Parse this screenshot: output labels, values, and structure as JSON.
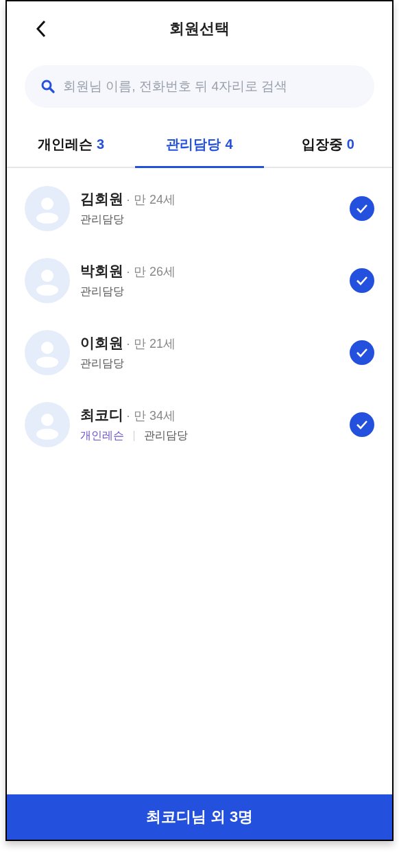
{
  "header": {
    "title": "회원선택"
  },
  "search": {
    "placeholder": "회원님 이름, 전화번호 뒤 4자리로 검색"
  },
  "tabs": [
    {
      "label": "개인레슨",
      "count": "3",
      "selected": false
    },
    {
      "label": "관리담당",
      "count": "4",
      "selected": true
    },
    {
      "label": "입장중",
      "count": "0",
      "selected": false
    }
  ],
  "members": [
    {
      "name": "김회원",
      "age": "· 만 24세",
      "checked": true,
      "tags": [
        {
          "label": "관리담당",
          "color": "#555555"
        }
      ]
    },
    {
      "name": "박회원",
      "age": "· 만 26세",
      "checked": true,
      "tags": [
        {
          "label": "관리담당",
          "color": "#555555"
        }
      ]
    },
    {
      "name": "이회원",
      "age": "· 만 21세",
      "checked": true,
      "tags": [
        {
          "label": "관리담당",
          "color": "#555555"
        }
      ]
    },
    {
      "name": "최코디",
      "age": "· 만 34세",
      "checked": true,
      "tags": [
        {
          "label": "개인레슨",
          "color": "#6a4fd0"
        },
        {
          "label": "관리담당",
          "color": "#555555"
        }
      ]
    }
  ],
  "confirm_button": {
    "label": "최코디님 외 3명"
  }
}
